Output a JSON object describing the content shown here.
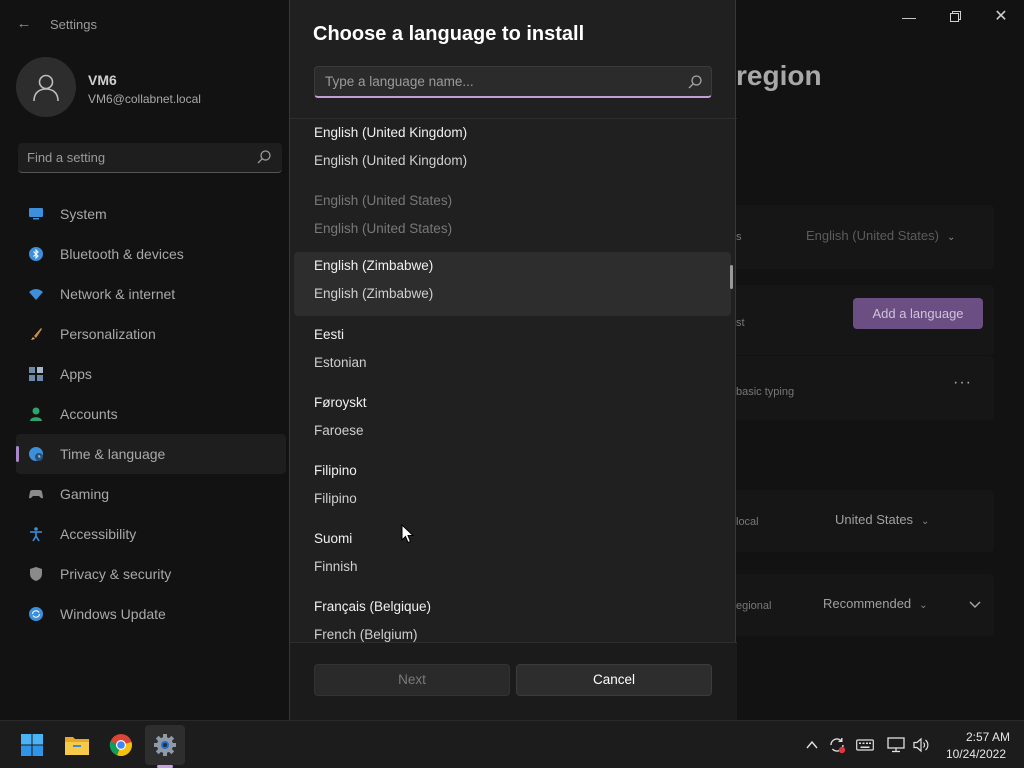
{
  "settings": {
    "app_title": "Settings",
    "user": {
      "name": "VM6",
      "email": "VM6@collabnet.local"
    },
    "search_placeholder": "Find a setting",
    "nav": [
      {
        "label": "System",
        "icon": "monitor-icon",
        "color": "#3d8fd9"
      },
      {
        "label": "Bluetooth & devices",
        "icon": "bluetooth-icon",
        "color": "#3d8fd9"
      },
      {
        "label": "Network & internet",
        "icon": "wifi-icon",
        "color": "#3d8fd9"
      },
      {
        "label": "Personalization",
        "icon": "brush-icon",
        "color": "#d08a4b"
      },
      {
        "label": "Apps",
        "icon": "apps-icon",
        "color": "#6f8aa8"
      },
      {
        "label": "Accounts",
        "icon": "person-icon",
        "color": "#2fa36b"
      },
      {
        "label": "Time & language",
        "icon": "globe-clock-icon",
        "color": "#3d8fd9",
        "active": true
      },
      {
        "label": "Gaming",
        "icon": "gamepad-icon",
        "color": "#8a8a8a"
      },
      {
        "label": "Accessibility",
        "icon": "accessibility-icon",
        "color": "#3d8fd9"
      },
      {
        "label": "Privacy & security",
        "icon": "shield-icon",
        "color": "#8a8a8a"
      },
      {
        "label": "Windows Update",
        "icon": "update-icon",
        "color": "#3d8fd9"
      }
    ],
    "page_title_partial": "region",
    "cards": {
      "display_language_partial": "s",
      "display_language_value": "English (United States)",
      "preferred_partial": "st",
      "add_language_label": "Add a language",
      "basic_typing_partial": "basic typing",
      "more_label": "···",
      "country_partial": "local",
      "country_value": "United States",
      "format_partial": "egional",
      "format_value": "Recommended"
    }
  },
  "dialog": {
    "title": "Choose a language to install",
    "search_placeholder": "Type a language name...",
    "languages": [
      {
        "native": "English (United Kingdom)",
        "english": "English (United Kingdom)"
      },
      {
        "native": "English (United States)",
        "english": "English (United States)",
        "disabled": true
      },
      {
        "native": "English (Zimbabwe)",
        "english": "English (Zimbabwe)",
        "hover": true
      },
      {
        "native": "Eesti",
        "english": "Estonian"
      },
      {
        "native": "Føroyskt",
        "english": "Faroese"
      },
      {
        "native": "Filipino",
        "english": "Filipino"
      },
      {
        "native": "Suomi",
        "english": "Finnish"
      },
      {
        "native": "Français (Belgique)",
        "english": "French (Belgium)"
      }
    ],
    "next_label": "Next",
    "cancel_label": "Cancel"
  },
  "taskbar": {
    "apps": [
      "start-icon",
      "file-explorer-icon",
      "chrome-icon",
      "settings-icon"
    ],
    "time": "2:57 AM",
    "date": "10/24/2022"
  },
  "colors": {
    "accent": "#c39fd6",
    "add_button": "#6b4e82",
    "dialog_bg": "#202020"
  }
}
